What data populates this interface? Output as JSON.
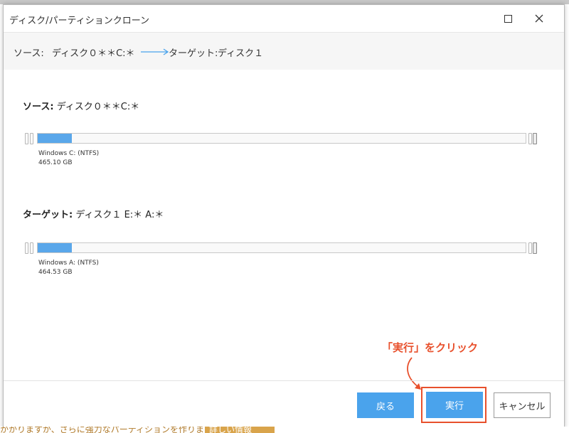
{
  "window": {
    "title": "ディスク/パーティションクローン"
  },
  "route": {
    "source_label": "ソース:",
    "source_value": "ディスク０＊＊C:＊",
    "target_label": "ターゲット:",
    "target_value": "ディスク１"
  },
  "source": {
    "label": "ソース:",
    "value": "ディスク０＊＊C:＊",
    "partition_name": "Windows C: (NTFS)",
    "partition_size": "465.10 GB",
    "used_fraction": 0.07
  },
  "target": {
    "label": "ターゲット:",
    "value": "ディスク１ E:＊ A:＊",
    "partition_name": "Windows A: (NTFS)",
    "partition_size": "464.53 GB",
    "used_fraction": 0.07
  },
  "annotation": {
    "text": "「実行」をクリック",
    "color": "#e8502c"
  },
  "buttons": {
    "back": "戻る",
    "execute": "実行",
    "cancel": "キャンセル"
  },
  "background": {
    "footer_text": "かかりますが、さらに強力なパーティションを作りましょう",
    "badge_text": "詳しい情報"
  },
  "colors": {
    "accent": "#4aa3ec",
    "bar_fill": "#5aa7ea",
    "highlight": "#e8502c"
  }
}
